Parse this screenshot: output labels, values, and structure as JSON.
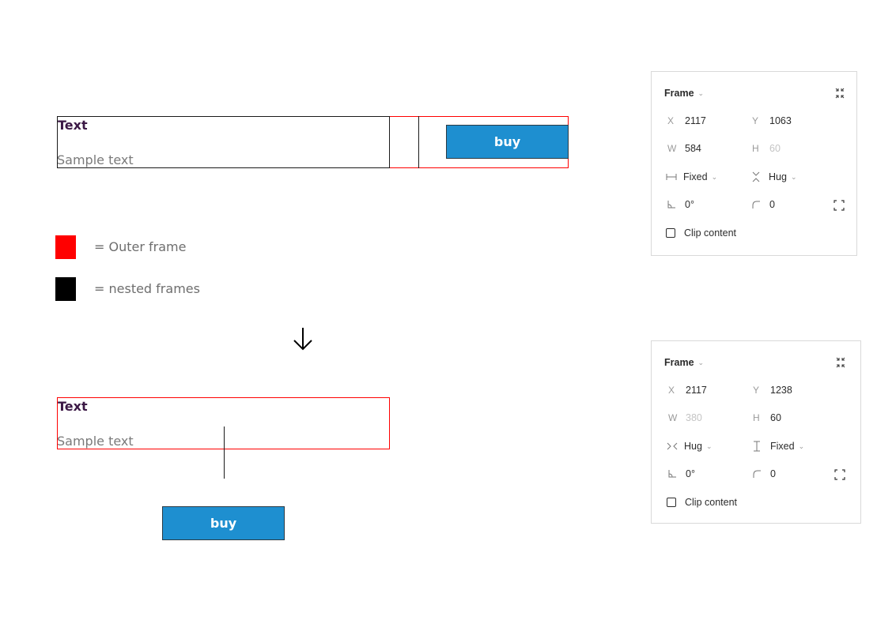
{
  "before": {
    "heading": "Text",
    "subtext": "Sample text",
    "button_label": "buy"
  },
  "legend": [
    {
      "color": "#ff0000",
      "label": "= Outer frame"
    },
    {
      "color": "#000000",
      "label": "= nested frames"
    }
  ],
  "arrow_icon": "arrow-down-icon",
  "after": {
    "heading": "Text",
    "subtext": "Sample text",
    "button_label": "buy"
  },
  "panel_top": {
    "title": "Frame",
    "x_label": "X",
    "x_value": "2117",
    "y_label": "Y",
    "y_value": "1063",
    "w_label": "W",
    "w_value": "584",
    "h_label": "H",
    "h_value": "60",
    "width_mode": "Fixed",
    "height_mode": "Hug",
    "rotation": "0°",
    "radius": "0",
    "clip_label": "Clip content"
  },
  "panel_bottom": {
    "title": "Frame",
    "x_label": "X",
    "x_value": "2117",
    "y_label": "Y",
    "y_value": "1238",
    "w_label": "W",
    "w_value": "380",
    "h_label": "H",
    "h_value": "60",
    "width_mode": "Hug",
    "height_mode": "Fixed",
    "rotation": "0°",
    "radius": "0",
    "clip_label": "Clip content"
  },
  "colors": {
    "outer_frame": "#ff0000",
    "nested_frame": "#000000",
    "button": "#1e8fd0",
    "heading_text": "#3b1845"
  }
}
